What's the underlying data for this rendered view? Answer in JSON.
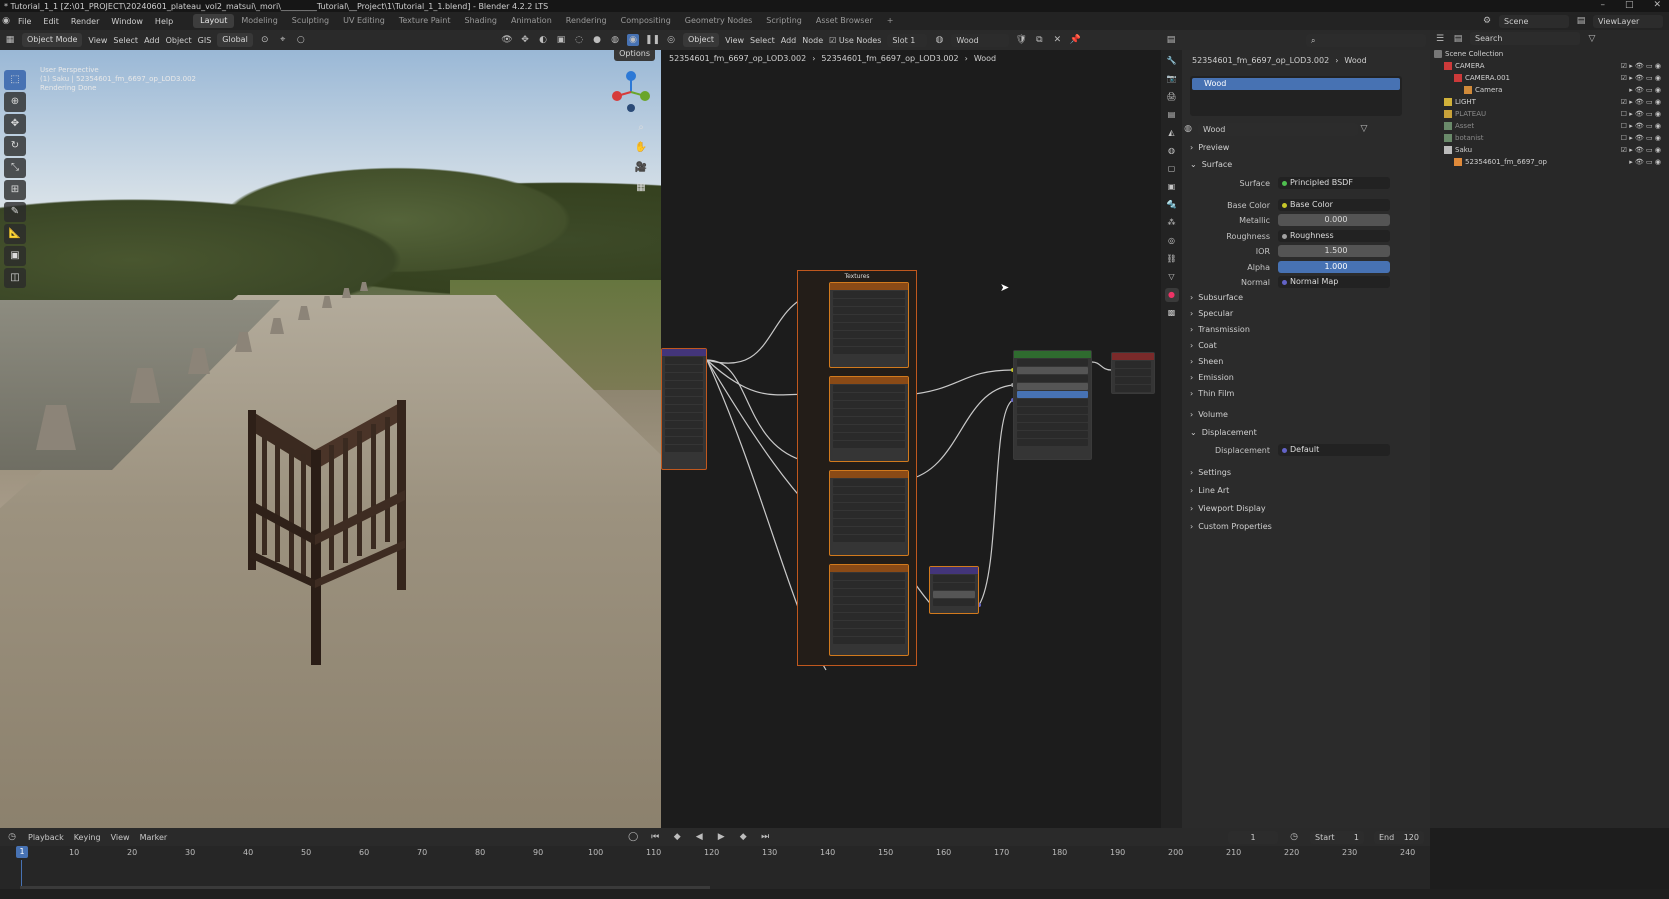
{
  "window": {
    "title": "* Tutorial_1_1 [Z:\\01_PROJECT\\20240601_plateau_vol2_matsui\\_mori\\_________Tutorial\\__Project\\1\\Tutorial_1_1.blend] - Blender 4.2.2 LTS"
  },
  "menu": [
    "File",
    "Edit",
    "Render",
    "Window",
    "Help"
  ],
  "workspaces": [
    "Layout",
    "Modeling",
    "Sculpting",
    "UV Editing",
    "Texture Paint",
    "Shading",
    "Animation",
    "Rendering",
    "Compositing",
    "Geometry Nodes",
    "Scripting",
    "Asset Browser"
  ],
  "workspace_add": "+",
  "scene": {
    "name": "Scene",
    "viewlayer": "ViewLayer"
  },
  "viewport": {
    "mode": "Object Mode",
    "menus": [
      "View",
      "Select",
      "Add",
      "Object"
    ],
    "gis": "GIS",
    "orientation": "Global",
    "options": "Options",
    "overlay_lines": [
      "User Perspective",
      "(1) Saku | 52354601_fm_6697_op_LOD3.002",
      "Rendering Done"
    ]
  },
  "nodeeditor": {
    "type": "Object",
    "menus": [
      "View",
      "Select",
      "Add",
      "Node"
    ],
    "use_nodes": "Use Nodes",
    "slot": "Slot 1",
    "material": "Wood",
    "breadcrumb": [
      "52354601_fm_6697_op_LOD3.002",
      "52354601_fm_6697_op_LOD3.002",
      "Wood"
    ],
    "frame_label": "Textures"
  },
  "properties": {
    "object": "52354601_fm_6697_op_LOD3.002",
    "material_tab": "Wood",
    "slot_item": "Wood",
    "material_name": "Wood",
    "preview": "Preview",
    "surface_section": "Surface",
    "rows": [
      {
        "label": "Surface",
        "value": "Principled BSDF"
      },
      {
        "label": "Base Color",
        "value": "Base Color"
      },
      {
        "label": "Metallic",
        "value": "0.000"
      },
      {
        "label": "Roughness",
        "value": "Roughness"
      },
      {
        "label": "IOR",
        "value": "1.500"
      },
      {
        "label": "Alpha",
        "value": "1.000"
      },
      {
        "label": "Normal",
        "value": "Normal Map"
      }
    ],
    "subsections": [
      "Subsurface",
      "Specular",
      "Transmission",
      "Coat",
      "Sheen",
      "Emission",
      "Thin Film"
    ],
    "volume": "Volume",
    "displacement_section": "Displacement",
    "displacement": {
      "label": "Displacement",
      "value": "Default"
    },
    "more": [
      "Settings",
      "Line Art",
      "Viewport Display",
      "Custom Properties"
    ]
  },
  "outliner": {
    "search": "Search",
    "items": [
      {
        "name": "Scene Collection",
        "indent": 0
      },
      {
        "name": "CAMERA",
        "indent": 1
      },
      {
        "name": "CAMERA.001",
        "indent": 2
      },
      {
        "name": "Camera",
        "indent": 3
      },
      {
        "name": "LIGHT",
        "indent": 1
      },
      {
        "name": "PLATEAU",
        "indent": 1
      },
      {
        "name": "Asset",
        "indent": 1
      },
      {
        "name": "botanist",
        "indent": 1
      },
      {
        "name": "Saku",
        "indent": 1
      },
      {
        "name": "52354601_fm_6697_op",
        "indent": 2
      }
    ]
  },
  "timeline": {
    "menus": [
      "Playback",
      "Keying",
      "View",
      "Marker"
    ],
    "current": "1",
    "start_label": "Start",
    "start": "1",
    "end_label": "End",
    "end": "120",
    "ticks": [
      "10",
      "20",
      "30",
      "40",
      "50",
      "60",
      "70",
      "80",
      "90",
      "100",
      "110",
      "120",
      "130",
      "140",
      "150",
      "160",
      "170",
      "180",
      "190",
      "200",
      "210",
      "220",
      "230",
      "240"
    ]
  }
}
